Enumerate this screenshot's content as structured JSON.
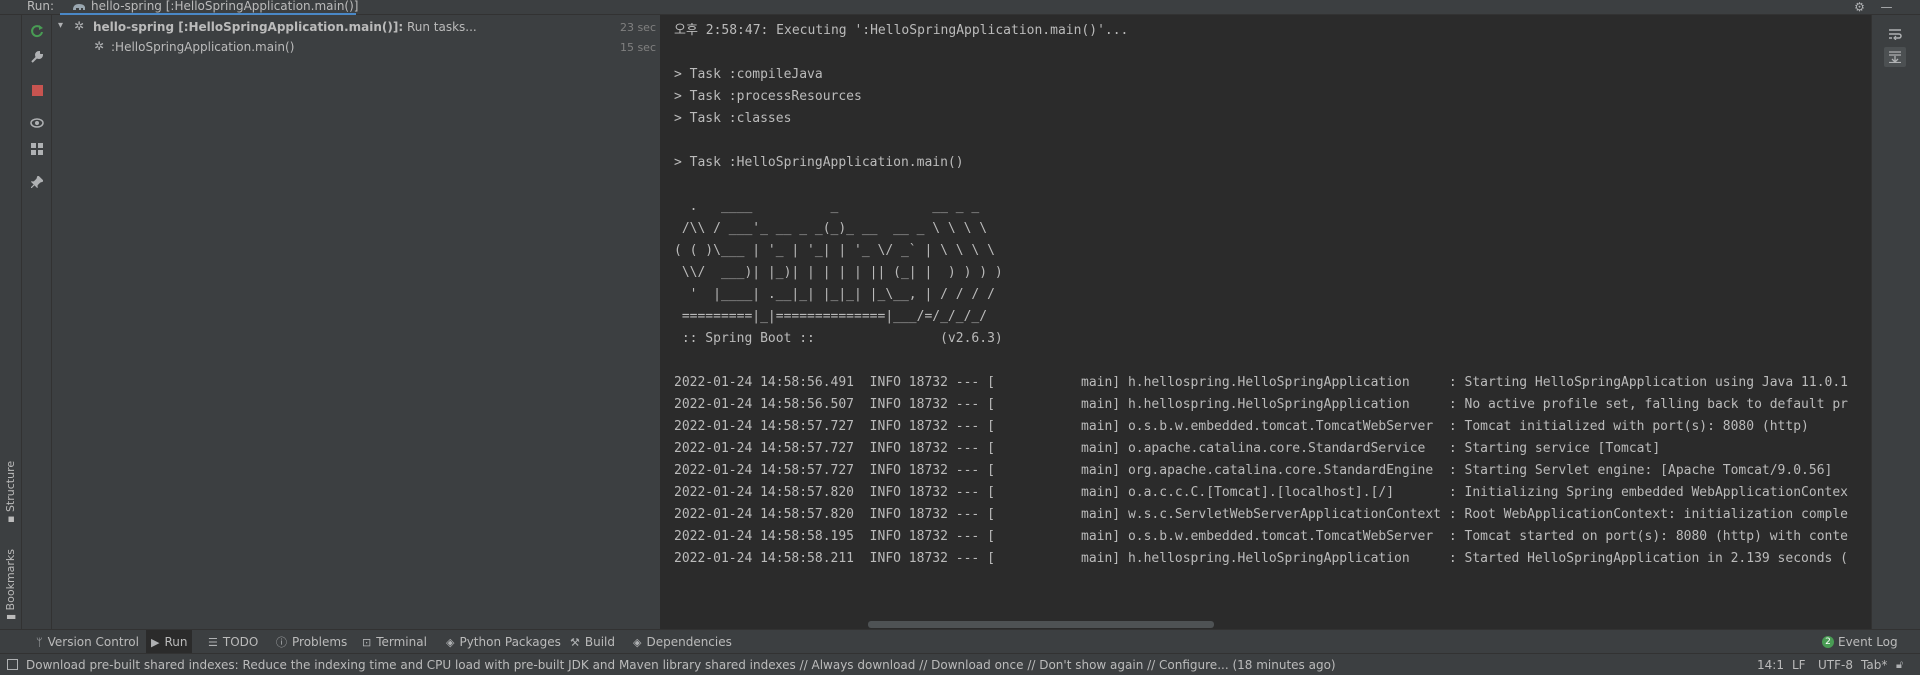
{
  "run_header": {
    "label": "Run:",
    "tab_title": "hello-spring [:HelloSpringApplication.main()]"
  },
  "left_strip": {
    "structure_label": "Structure",
    "bookmarks_label": "Bookmarks"
  },
  "tree": {
    "rows": [
      {
        "name_bold": "hello-spring [:HelloSpringApplication.main()]:",
        "name_rest": " Run tasks...",
        "time": "23 sec"
      },
      {
        "name_bold": "",
        "name_rest": ":HelloSpringApplication.main()",
        "time": "15 sec"
      }
    ]
  },
  "console": {
    "lines": [
      "오후 2:58:47: Executing ':HelloSpringApplication.main()'...",
      "",
      "> Task :compileJava",
      "> Task :processResources",
      "> Task :classes",
      "",
      "> Task :HelloSpringApplication.main()",
      "",
      "  .   ____          _            __ _ _",
      " /\\\\ / ___'_ __ _ _(_)_ __  __ _ \\ \\ \\ \\",
      "( ( )\\___ | '_ | '_| | '_ \\/ _` | \\ \\ \\ \\",
      " \\\\/  ___)| |_)| | | | | || (_| |  ) ) ) )",
      "  '  |____| .__|_| |_|_| |_\\__, | / / / /",
      " =========|_|==============|___/=/_/_/_/",
      " :: Spring Boot ::                (v2.6.3)",
      "",
      "2022-01-24 14:58:56.491  INFO 18732 --- [           main] h.hellospring.HelloSpringApplication     : Starting HelloSpringApplication using Java 11.0.1",
      "2022-01-24 14:58:56.507  INFO 18732 --- [           main] h.hellospring.HelloSpringApplication     : No active profile set, falling back to default pr",
      "2022-01-24 14:58:57.727  INFO 18732 --- [           main] o.s.b.w.embedded.tomcat.TomcatWebServer  : Tomcat initialized with port(s): 8080 (http)",
      "2022-01-24 14:58:57.727  INFO 18732 --- [           main] o.apache.catalina.core.StandardService   : Starting service [Tomcat]",
      "2022-01-24 14:58:57.727  INFO 18732 --- [           main] org.apache.catalina.core.StandardEngine  : Starting Servlet engine: [Apache Tomcat/9.0.56]",
      "2022-01-24 14:58:57.820  INFO 18732 --- [           main] o.a.c.c.C.[Tomcat].[localhost].[/]       : Initializing Spring embedded WebApplicationContex",
      "2022-01-24 14:58:57.820  INFO 18732 --- [           main] w.s.c.ServletWebServerApplicationContext : Root WebApplicationContext: initialization comple",
      "2022-01-24 14:58:58.195  INFO 18732 --- [           main] o.s.b.w.embedded.tomcat.TomcatWebServer  : Tomcat started on port(s): 8080 (http) with conte",
      "2022-01-24 14:58:58.211  INFO 18732 --- [           main] h.hellospring.HelloSpringApplication     : Started HelloSpringApplication in 2.139 seconds ("
    ]
  },
  "tool_windows": {
    "version_control": "Version Control",
    "run": "Run",
    "todo": "TODO",
    "problems": "Problems",
    "terminal": "Terminal",
    "python_packages": "Python Packages",
    "build": "Build",
    "dependencies": "Dependencies",
    "event_log": "Event Log",
    "event_log_count": "2"
  },
  "status_bar": {
    "message": "Download pre-built shared indexes: Reduce the indexing time and CPU load with pre-built JDK and Maven library shared indexes // Always download // Download once // Don't show again // Configure... (18 minutes ago)",
    "position": "14:1",
    "line_separator": "LF",
    "encoding": "UTF-8",
    "indent": "Tab*"
  },
  "colors": {
    "accent_blue": "#4a88c7",
    "stop_red": "#c75450",
    "rerun_green": "#499c54",
    "event_green": "#499c54"
  }
}
